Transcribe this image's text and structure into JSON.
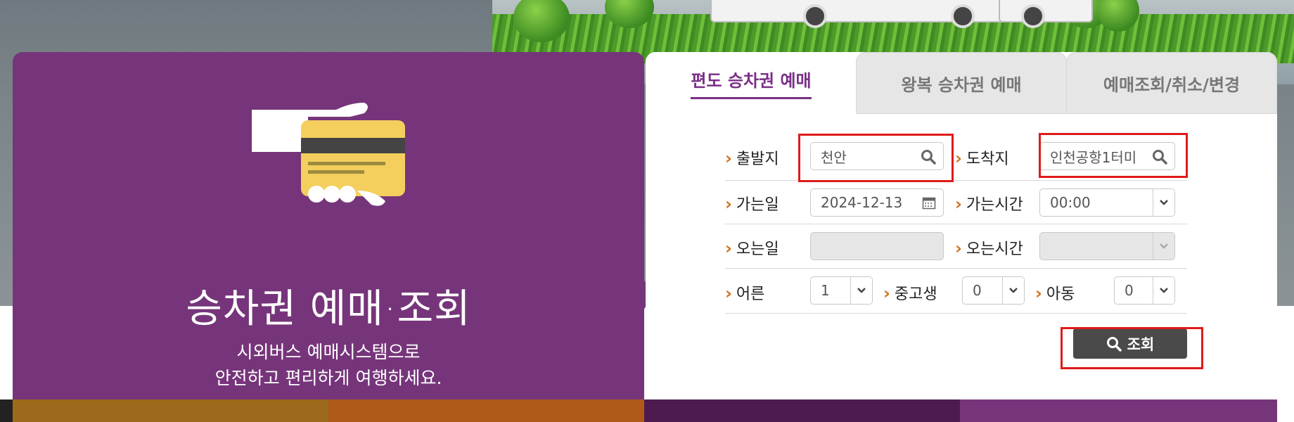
{
  "panel": {
    "title": "승차권 예매·조회",
    "subtitle_line1": "시외버스 예매시스템으로",
    "subtitle_line2": "안전하고 편리하게 여행하세요."
  },
  "tabs": [
    {
      "label": "편도 승차권 예매",
      "active": true
    },
    {
      "label": "왕복 승차권 예매",
      "active": false
    },
    {
      "label": "예매조회/취소/변경",
      "active": false
    }
  ],
  "form": {
    "departure_label": "출발지",
    "departure_value": "천안",
    "arrival_label": "도착지",
    "arrival_value": "인천공항1터미",
    "go_date_label": "가는일",
    "go_date_value": "2024-12-13",
    "go_time_label": "가는시간",
    "go_time_value": "00:00",
    "return_date_label": "오는일",
    "return_date_value": "",
    "return_time_label": "오는시간",
    "return_time_value": "",
    "adult_label": "어른",
    "adult_value": "1",
    "teen_label": "중고생",
    "teen_value": "0",
    "child_label": "아동",
    "child_value": "0"
  },
  "search_button_label": "조회",
  "colors": {
    "purple": "#76357a",
    "accent_tab": "#7a2f86",
    "highlight_red": "#e01a1a",
    "bar_1": "#9b6a1d",
    "bar_2": "#b05a1a",
    "bar_3": "#4e1b51",
    "bar_4": "#76357a"
  },
  "icons": [
    "magnifier-icon",
    "calendar-icon",
    "chevron-down-icon",
    "ticket-hand-illustration"
  ]
}
